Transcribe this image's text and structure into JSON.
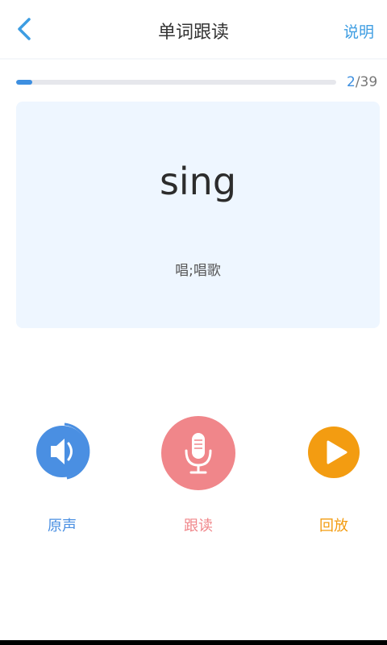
{
  "header": {
    "title": "单词跟读",
    "help_label": "说明"
  },
  "progress": {
    "current": "2",
    "separator_total": "/39",
    "fraction": 0.05
  },
  "card": {
    "word": "sing",
    "meaning": "唱;唱歌"
  },
  "controls": {
    "original": {
      "label": "原声",
      "icon": "speaker-icon",
      "color": "#4a8fe2"
    },
    "record": {
      "label": "跟读",
      "icon": "microphone-icon",
      "color": "#f0868a"
    },
    "playback": {
      "label": "回放",
      "icon": "play-icon",
      "color": "#f39c11"
    }
  },
  "colors": {
    "accent": "#3d9de2",
    "card_bg": "#eef6ff"
  }
}
